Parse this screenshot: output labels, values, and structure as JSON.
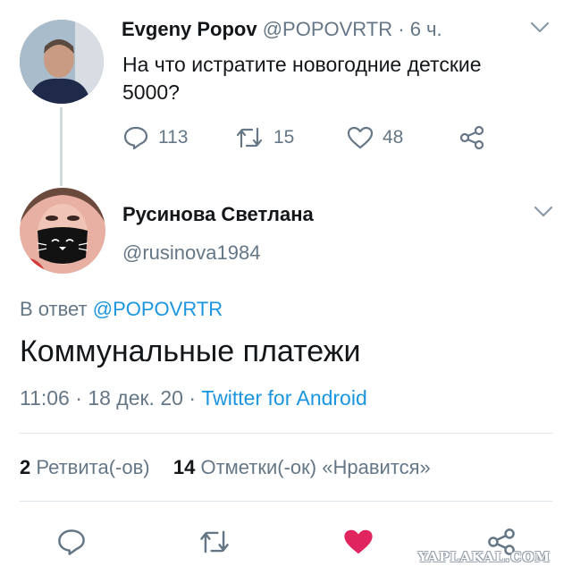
{
  "tweet1": {
    "author_name": "Evgeny Popov",
    "handle": "@POPOVRTR",
    "separator": "·",
    "time": "6 ч.",
    "text_line1": "На что истратите новогодние детские",
    "text_line2": "5000?",
    "replies": "113",
    "retweets": "15",
    "likes": "48"
  },
  "tweet2": {
    "author_name": "Русинова Светлана",
    "handle": "@rusinova1984",
    "reply_prefix": "В ответ",
    "reply_to": "@POPOVRTR",
    "text": "Коммунальные платежи",
    "time": "11:06",
    "sep1": "·",
    "date": "18 дек. 20",
    "sep2": "·",
    "source": "Twitter for Android",
    "retweet_count": "2",
    "retweet_label": "Ретвита(-ов)",
    "like_count": "14",
    "like_label": "Отметки(-ок) «Нравится»"
  },
  "watermark": "YAPLAKAL.COM",
  "colors": {
    "link": "#1b95e0",
    "muted": "#657786",
    "like_active": "#e0245e"
  },
  "icons": [
    "chevron-down-icon",
    "reply-icon",
    "retweet-icon",
    "like-icon",
    "share-icon"
  ]
}
